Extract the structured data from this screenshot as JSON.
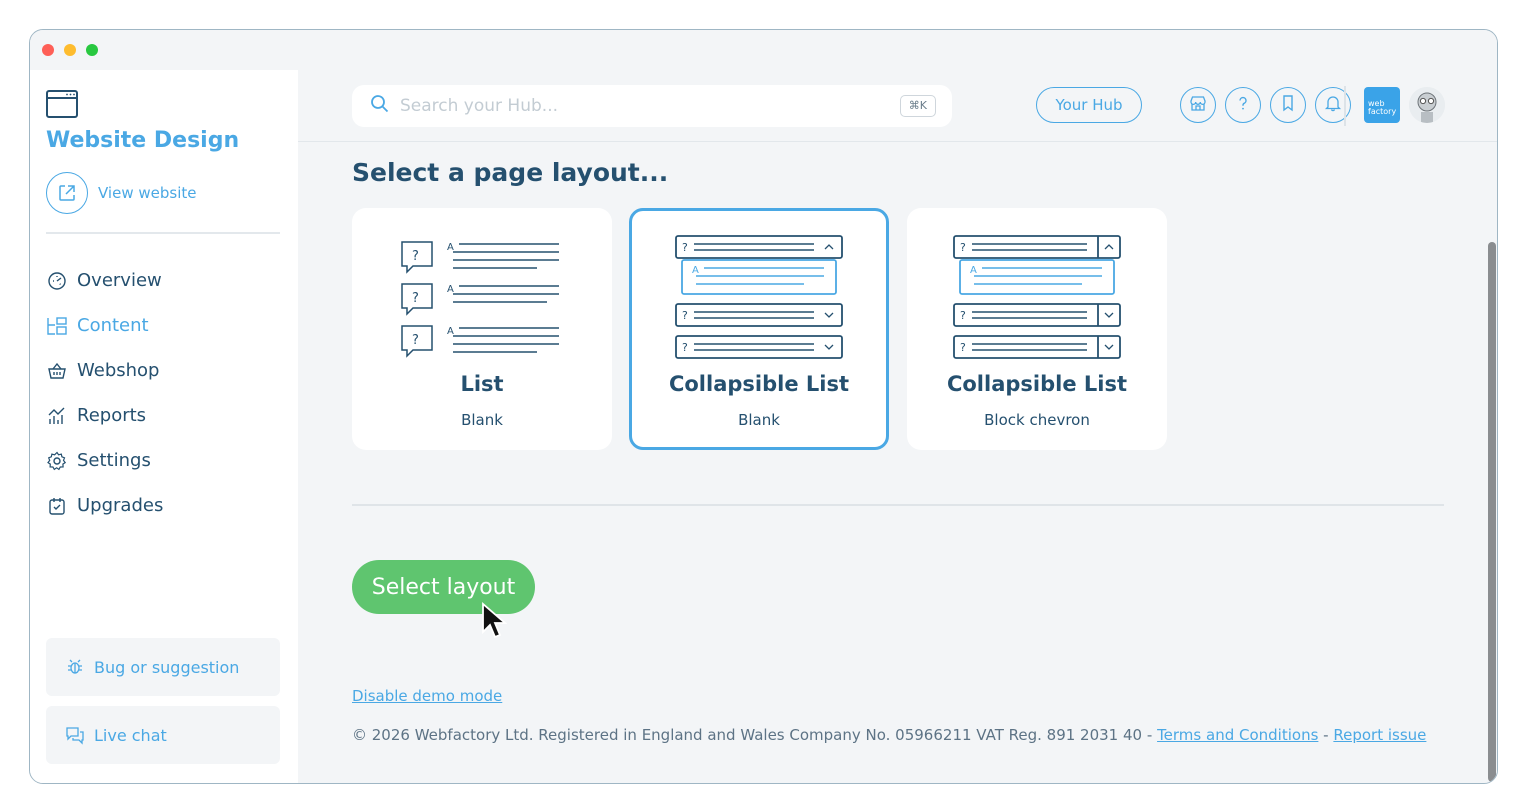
{
  "sidebar": {
    "app_title": "Website Design",
    "view_website_label": "View website",
    "nav": [
      {
        "label": "Overview",
        "icon": "dashboard-icon"
      },
      {
        "label": "Content",
        "icon": "content-icon"
      },
      {
        "label": "Webshop",
        "icon": "basket-icon"
      },
      {
        "label": "Reports",
        "icon": "chart-icon"
      },
      {
        "label": "Settings",
        "icon": "gear-icon"
      },
      {
        "label": "Upgrades",
        "icon": "upgrade-icon"
      }
    ],
    "active_item": "Content",
    "bug_label": "Bug or suggestion",
    "chat_label": "Live chat"
  },
  "header": {
    "search_placeholder": "Search your Hub...",
    "search_shortcut": "⌘K",
    "hub_button_label": "Your Hub",
    "icon_buttons": [
      "store-icon",
      "help-icon",
      "bookmark-icon",
      "bell-icon"
    ],
    "logo_text": "web factory"
  },
  "main": {
    "heading": "Select a page layout...",
    "cards": [
      {
        "name": "List",
        "sub": "Blank",
        "selected": false
      },
      {
        "name": "Collapsible List",
        "sub": "Blank",
        "selected": true
      },
      {
        "name": "Collapsible List",
        "sub": "Block chevron",
        "selected": false
      }
    ],
    "select_button_label": "Select layout",
    "demo_link_label": "Disable demo mode",
    "footer": {
      "text": "© 2026 Webfactory Ltd. Registered in England and Wales Company No. 05966211 VAT Reg. 891 2031 40 -",
      "terms_label": "Terms and Conditions",
      "separator": "-",
      "report_label": "Report issue"
    }
  },
  "colors": {
    "accent": "#4aa8e4",
    "primary_text": "#25506f",
    "success": "#5fc56f",
    "background": "#f3f5f7"
  }
}
